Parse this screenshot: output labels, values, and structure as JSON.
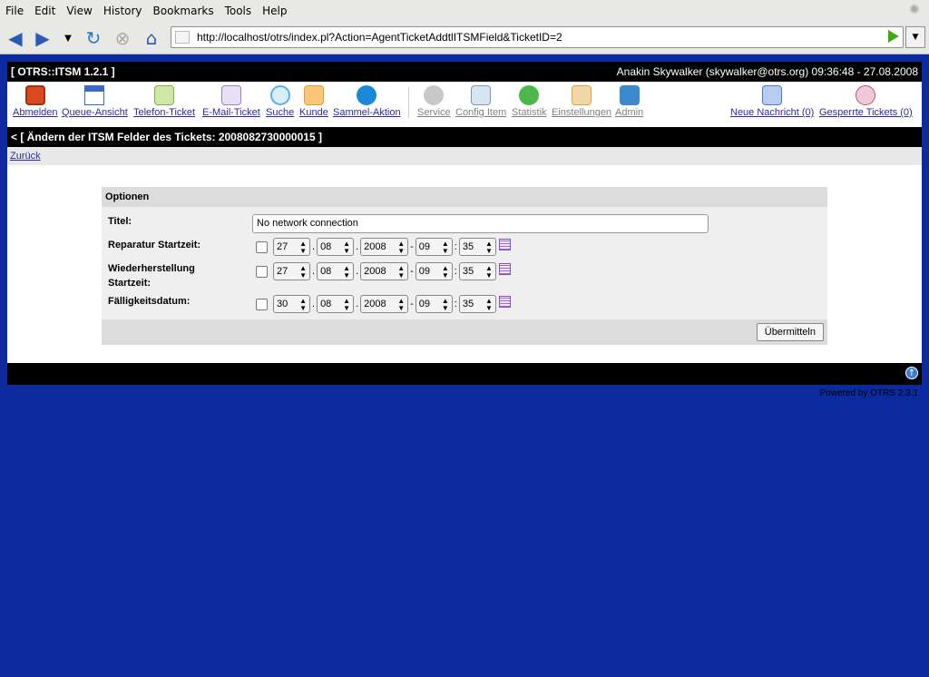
{
  "browser": {
    "menu": [
      "File",
      "Edit",
      "View",
      "History",
      "Bookmarks",
      "Tools",
      "Help"
    ],
    "url": "http://localhost/otrs/index.pl?Action=AgentTicketAddtlITSMField&TicketID=2"
  },
  "otrs": {
    "app_title": "[ OTRS::ITSM 1.2.1 ]",
    "user_info": "Anakin Skywalker (skywalker@otrs.org) 09:36:48 - 27.08.2008",
    "toolbar": [
      {
        "label": "Abmelden",
        "icon": "logout-icon",
        "color": "#d84a20"
      },
      {
        "label": "Queue-Ansicht",
        "icon": "queue-view-icon",
        "color": "#3a6ac8"
      },
      {
        "label": "Telefon-Ticket",
        "icon": "phone-ticket-icon",
        "color": "#7ab33a"
      },
      {
        "label": "E-Mail-Ticket",
        "icon": "email-ticket-icon",
        "color": "#9a80c0"
      },
      {
        "label": "Suche",
        "icon": "search-icon",
        "color": "#5ab0e8"
      },
      {
        "label": "Kunde",
        "icon": "customer-icon",
        "color": "#e89a30"
      },
      {
        "label": "Sammel-Aktion",
        "icon": "bulk-action-icon",
        "color": "#1a8ad8"
      },
      {
        "label": "Service",
        "icon": "service-icon",
        "color": "#8a8a8a"
      },
      {
        "label": "Config Item",
        "icon": "config-item-icon",
        "color": "#7a9ab8"
      },
      {
        "label": "Statistik",
        "icon": "statistics-icon",
        "color": "#4ab84a"
      },
      {
        "label": "Einstellungen",
        "icon": "settings-icon",
        "color": "#e0a040"
      },
      {
        "label": "Admin",
        "icon": "admin-icon",
        "color": "#3a8ad0"
      },
      {
        "label": "Neue Nachricht (0)",
        "icon": "new-message-icon",
        "color": "#4a7ad8"
      },
      {
        "label": "Gesperrte Tickets (0)",
        "icon": "locked-tickets-icon",
        "color": "#c05080"
      }
    ],
    "page_heading": "< [ Ändern der ITSM Felder des Tickets: 2008082730000015 ]",
    "back_link": "Zurück",
    "form": {
      "section_title": "Optionen",
      "title_label": "Titel:",
      "title_value": "No network connection",
      "repair_label": "Reparatur Startzeit:",
      "recovery_label_1": "Wiederherstellung",
      "recovery_label_2": "Startzeit:",
      "due_label": "Fälligkeitsdatum:",
      "repair": {
        "day": "27",
        "month": "08",
        "year": "2008",
        "hour": "09",
        "minute": "35"
      },
      "recovery": {
        "day": "27",
        "month": "08",
        "year": "2008",
        "hour": "09",
        "minute": "35"
      },
      "due": {
        "day": "30",
        "month": "08",
        "year": "2008",
        "hour": "09",
        "minute": "35"
      },
      "submit_label": "Übermitteln"
    },
    "powered_by": "Powered by OTRS 2.3.1"
  }
}
